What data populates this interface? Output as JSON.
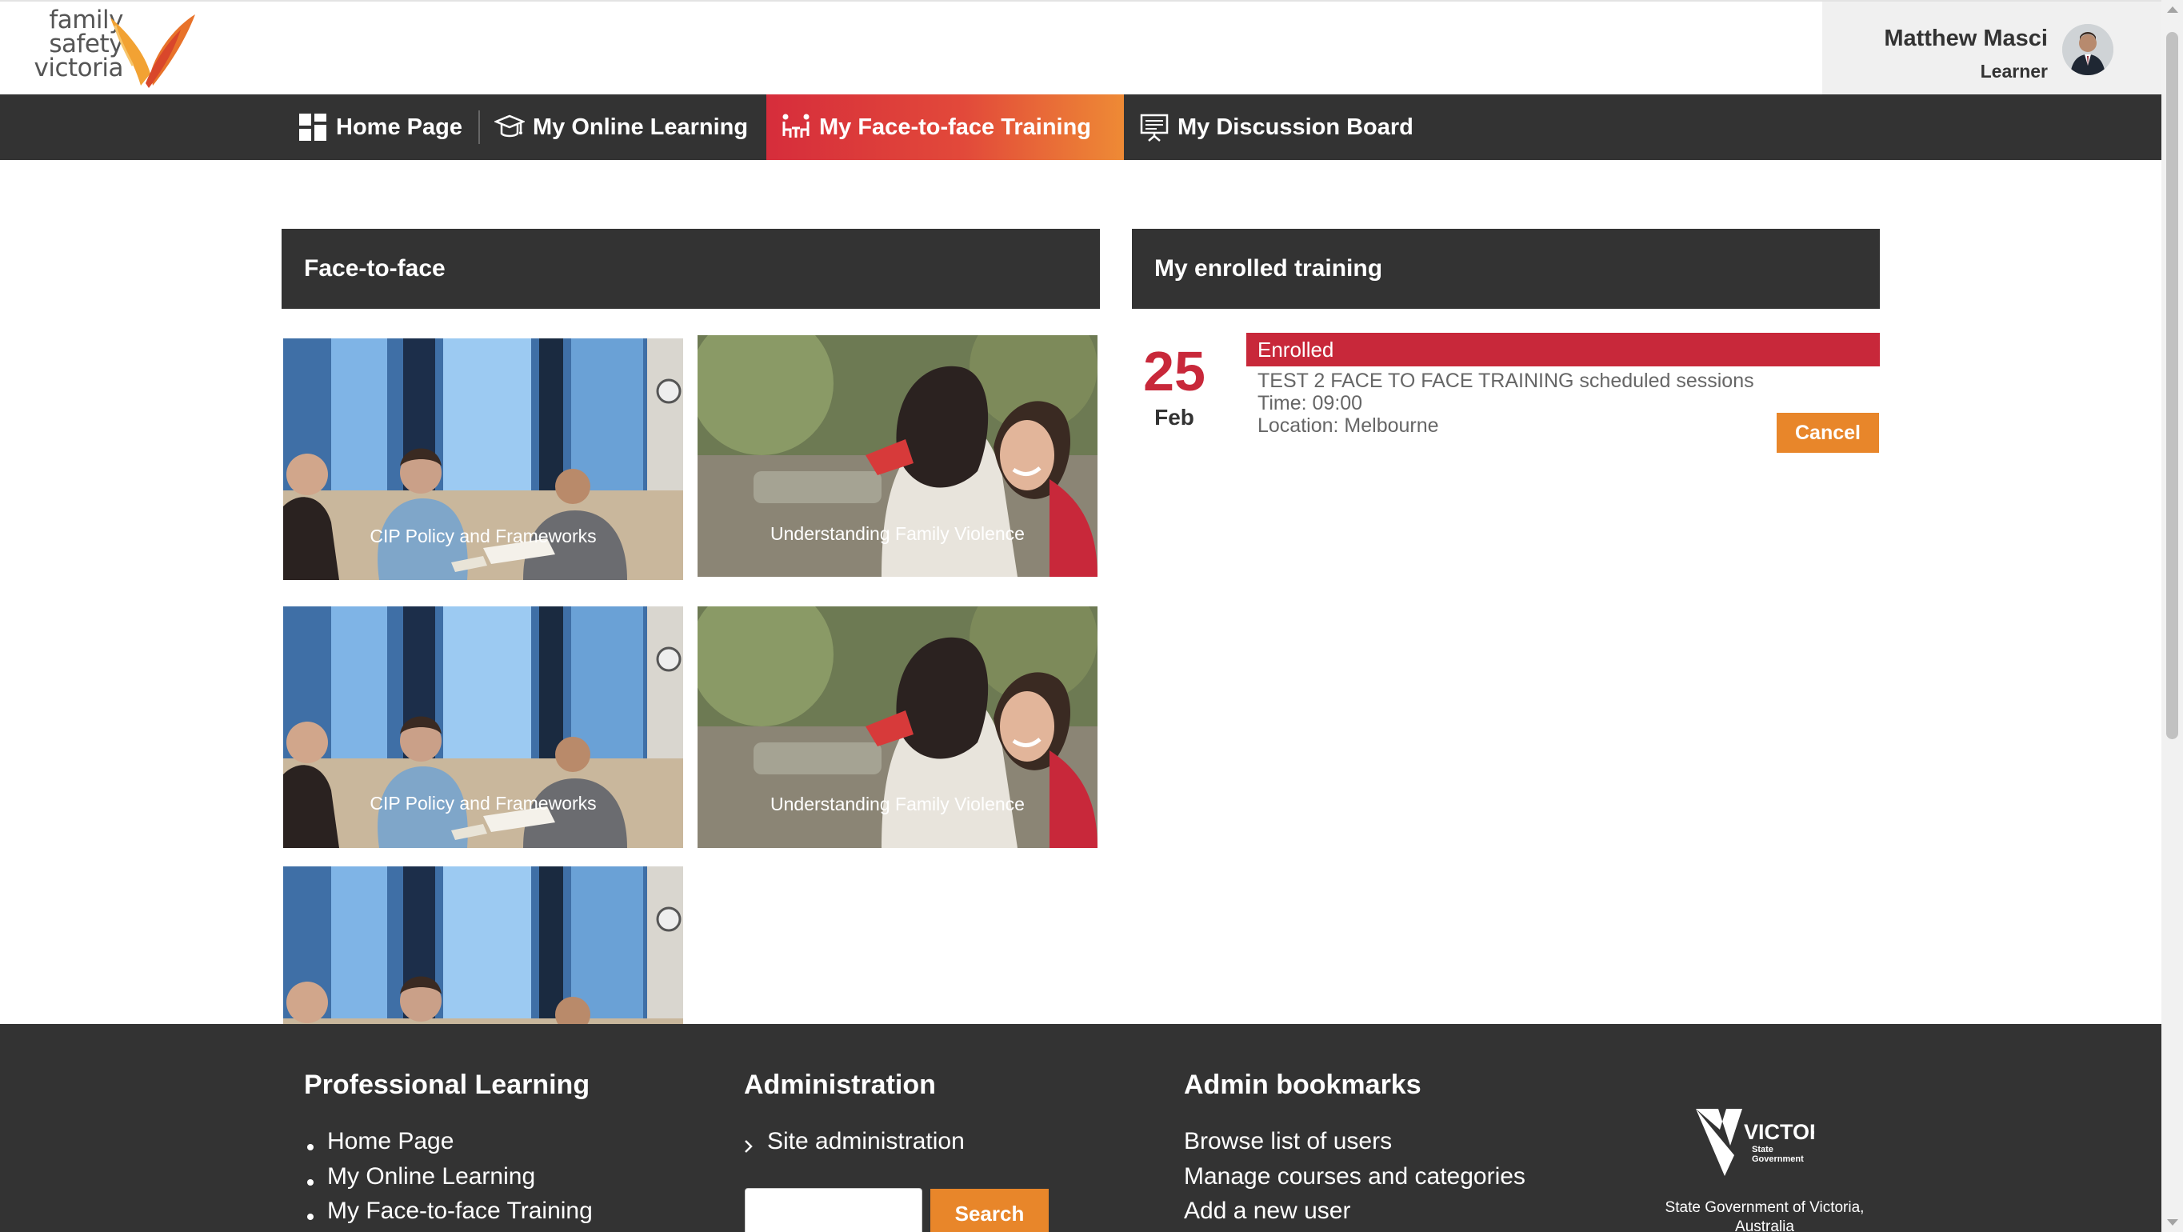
{
  "header": {
    "logo": {
      "line1": "family",
      "line2": "safety",
      "line3": "victoria"
    },
    "user": {
      "name": "Matthew Masci",
      "role": "Learner"
    }
  },
  "nav": {
    "items": [
      {
        "label": "Home Page",
        "icon": "grid-icon"
      },
      {
        "label": "My Online Learning",
        "icon": "graduation-cap-icon"
      },
      {
        "label": "My Face-to-face Training",
        "icon": "people-table-icon",
        "active": true
      },
      {
        "label": "My Discussion Board",
        "icon": "presentation-board-icon"
      }
    ]
  },
  "face_to_face": {
    "heading": "Face-to-face",
    "tiles": [
      {
        "label": "CIP Policy and Frameworks",
        "image": "meeting-room-photo"
      },
      {
        "label": "Understanding Family Violence",
        "image": "hug-photo"
      },
      {
        "label": "CIP Policy and Frameworks",
        "image": "meeting-room-photo"
      },
      {
        "label": "Understanding Family Violence",
        "image": "hug-photo"
      },
      {
        "label": "",
        "image": "meeting-room-photo"
      }
    ]
  },
  "enrolled": {
    "heading": "My enrolled training",
    "day": "25",
    "month": "Feb",
    "status": "Enrolled",
    "title": "TEST 2 FACE TO FACE TRAINING scheduled sessions",
    "time": "Time: 09:00",
    "location": "Location: Melbourne",
    "cancel_label": "Cancel"
  },
  "footer": {
    "professional_learning": {
      "title": "Professional Learning",
      "links": [
        "Home Page",
        "My Online Learning",
        "My Face-to-face Training"
      ]
    },
    "administration": {
      "title": "Administration",
      "link": "Site administration",
      "search_label": "Search"
    },
    "admin_bookmarks": {
      "title": "Admin bookmarks",
      "links": [
        "Browse list of users",
        "Manage courses and categories",
        "Add a new user"
      ]
    },
    "victoria": {
      "logo_text": "VICTORIA",
      "logo_sub1": "State",
      "logo_sub2": "Government",
      "caption": "State Government of Victoria, Australia"
    }
  },
  "colors": {
    "dark_bar": "#333333",
    "accent_red": "#c8283a",
    "accent_orange": "#e8862a"
  }
}
